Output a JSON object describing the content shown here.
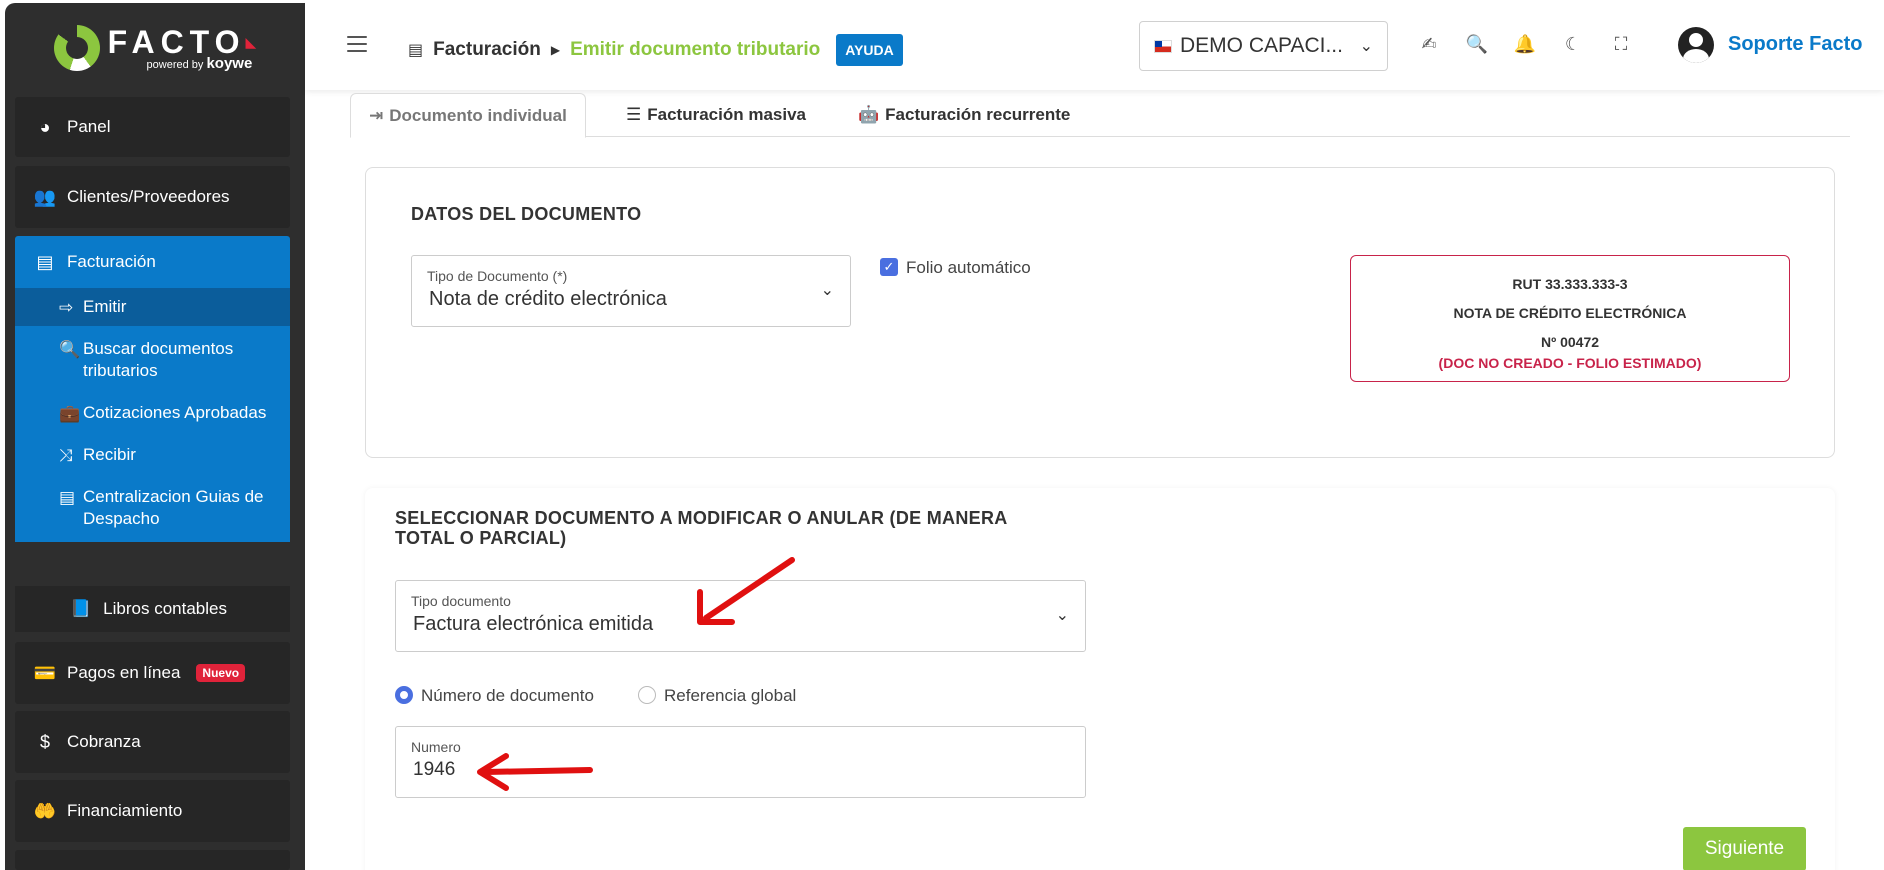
{
  "sidebar": {
    "logo": {
      "word": "FACTO",
      "powered": "powered by",
      "brand": "koywe"
    },
    "items": [
      {
        "label": "Panel",
        "icon": "chart-pie-icon"
      },
      {
        "label": "Clientes/Proveedores",
        "icon": "users-icon"
      },
      {
        "label": "Facturación",
        "icon": "file-icon"
      },
      {
        "label": "Pagos en línea",
        "icon": "payment-card-icon",
        "badge": "Nuevo"
      },
      {
        "label": "Cobranza",
        "icon": "dollar-icon"
      },
      {
        "label": "Financiamiento",
        "icon": "hand-money-icon"
      }
    ],
    "subitems": [
      {
        "label": "Emitir",
        "icon": "sign-out-icon"
      },
      {
        "label": "Buscar documentos tributarios",
        "icon": "search-icon"
      },
      {
        "label": "Cotizaciones Aprobadas",
        "icon": "briefcase-icon"
      },
      {
        "label": "Recibir",
        "icon": "shuffle-icon"
      },
      {
        "label": "Centralizacion Guias de Despacho",
        "icon": "file-icon"
      }
    ],
    "libros": {
      "label": "Libros contables",
      "icon": "book-icon"
    }
  },
  "header": {
    "breadcrumb": [
      "Facturación",
      "Emitir documento tributario"
    ],
    "help_label": "AYUDA",
    "company": "DEMO CAPACI...",
    "user": "Soporte Facto",
    "accent": "#0a7ac9",
    "green": "#8cc63f"
  },
  "tabs": [
    {
      "label": "Documento individual",
      "icon": "sign-in-icon"
    },
    {
      "label": "Facturación masiva",
      "icon": "list-icon"
    },
    {
      "label": "Facturación recurrente",
      "icon": "robot-icon"
    }
  ],
  "datos": {
    "title": "DATOS DEL DOCUMENTO",
    "tipo_label": "Tipo de Documento (*)",
    "tipo_value": "Nota de crédito electrónica",
    "folio_auto": "Folio automático",
    "box": {
      "rut": "RUT 33.333.333-3",
      "doc": "NOTA DE CRÉDITO ELECTRÓNICA",
      "num": "Nº 00472",
      "status": "(DOC NO CREADO - FOLIO ESTIMADO)"
    }
  },
  "seleccionar": {
    "title_line1": "SELECCIONAR DOCUMENTO A MODIFICAR O ANULAR (DE MANERA",
    "title_line2": "TOTAL O PARCIAL)",
    "tipo_label": "Tipo documento",
    "tipo_value": "Factura electrónica emitida",
    "radio_numero": "Número de documento",
    "radio_global": "Referencia global",
    "numero_label": "Numero",
    "numero_value": "1946",
    "next": "Siguiente"
  }
}
